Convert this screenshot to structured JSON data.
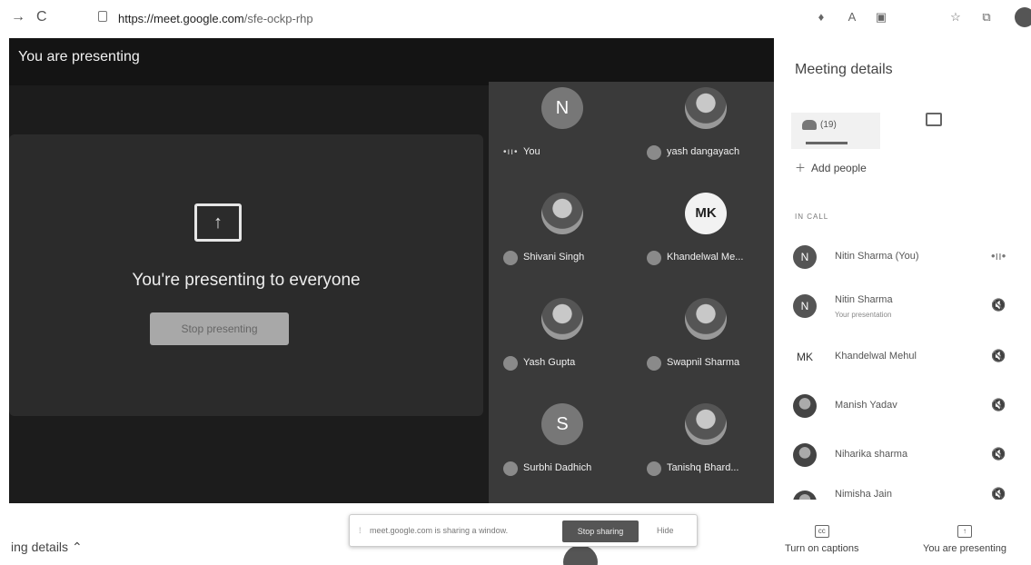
{
  "browser": {
    "url_domain": "https://meet.google.com",
    "url_path": "/sfe-ockp-rhp"
  },
  "stage": {
    "banner": "You are presenting",
    "present_message": "You're presenting to everyone",
    "stop_presenting": "Stop presenting"
  },
  "tiles": [
    {
      "name": "You",
      "initial": "N",
      "kind": "initial",
      "speaking": true
    },
    {
      "name": "yash dangayach",
      "initial": "",
      "kind": "photo"
    },
    {
      "name": "Shivani Singh",
      "initial": "",
      "kind": "photo"
    },
    {
      "name": "Khandelwal Me...",
      "initial": "MK",
      "kind": "logo"
    },
    {
      "name": "Yash Gupta",
      "initial": "",
      "kind": "photo"
    },
    {
      "name": "Swapnil Sharma",
      "initial": "",
      "kind": "photo"
    },
    {
      "name": "Surbhi Dadhich",
      "initial": "S",
      "kind": "initial"
    },
    {
      "name": "Tanishq Bhard...",
      "initial": "",
      "kind": "photo"
    }
  ],
  "side": {
    "title": "Meeting details",
    "people_count": "(19)",
    "add_people": "Add people",
    "in_call": "IN CALL",
    "people": [
      {
        "name": "Nitin Sharma (You)",
        "sub": "",
        "initial": "N",
        "mic": "•ıı•"
      },
      {
        "name": "Nitin Sharma",
        "sub": "Your presentation",
        "initial": "N",
        "mic": "🔇"
      },
      {
        "name": "Khandelwal Mehul",
        "sub": "",
        "initial": "MK",
        "mic": "🔇"
      },
      {
        "name": "Manish Yadav",
        "sub": "",
        "initial": "",
        "mic": "🔇"
      },
      {
        "name": "Niharika sharma",
        "sub": "",
        "initial": "",
        "mic": "🔇"
      },
      {
        "name": "Nimisha Jain",
        "sub": "",
        "initial": "",
        "mic": "🔇"
      }
    ]
  },
  "bottom": {
    "meeting_details": "ing details",
    "share_message": "meet.google.com is sharing a window.",
    "stop_sharing": "Stop sharing",
    "hide": "Hide",
    "captions": "Turn on captions",
    "presenting": "You are presenting"
  }
}
